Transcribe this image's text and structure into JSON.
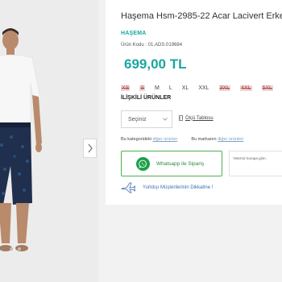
{
  "product": {
    "title": "Haşema Hsm-2985-22 Acar Lacivert Erkek Haşema",
    "brand": "HAŞEMA",
    "code": "Ürün Kodu : 01.ADS.019684",
    "price": "699,00 TL"
  },
  "sizes": [
    {
      "label": "XS",
      "available": false
    },
    {
      "label": "S",
      "available": false
    },
    {
      "label": "M",
      "available": true
    },
    {
      "label": "L",
      "available": true
    },
    {
      "label": "XL",
      "available": true
    },
    {
      "label": "XXL",
      "available": true
    },
    {
      "label": "3XL",
      "available": false
    },
    {
      "label": "4XL",
      "available": false
    },
    {
      "label": "5XL",
      "available": false
    }
  ],
  "related": {
    "heading": "İLİŞKİLİ ÜRÜNLER",
    "select_label": "Seçiniz",
    "size_chart": "Ölçü Tablosu"
  },
  "links": {
    "category_text": "Bu kategorideki",
    "category_link": "diğer ürünler",
    "brand_text": "Bu markanın",
    "brand_link": "diğer ürünleri"
  },
  "whatsapp": {
    "label": "Whatsapp ile Sipariş",
    "color": "#1ca04a"
  },
  "stock_note": "Yetersiz kurupa girin.",
  "notice": "Yurtdışı Müşterilerinin Dikkatine !",
  "gallery": {
    "dots": 3,
    "active_dot": 0
  },
  "colors": {
    "accent": "#1aa6a0",
    "unavailable_bg": "#f1d5d5",
    "link": "#7aa3c8",
    "notice": "#3a6fb0"
  }
}
